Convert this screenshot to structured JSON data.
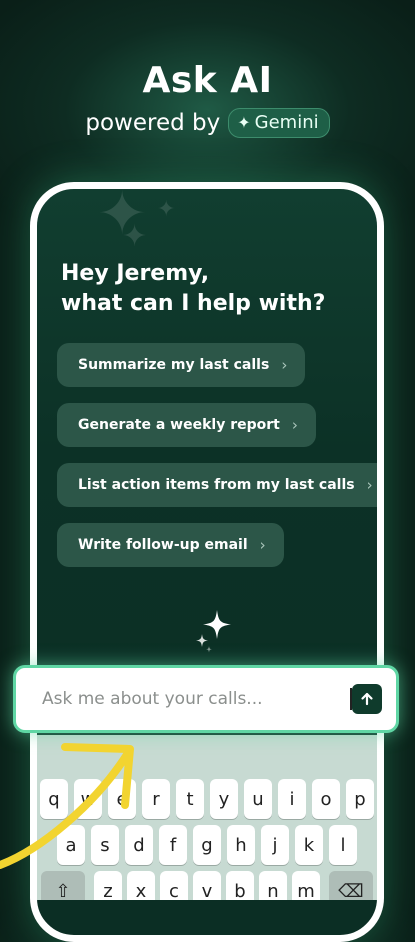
{
  "header": {
    "title": "Ask AI",
    "powered_by": "powered by",
    "badge_label": "Gemini"
  },
  "assistant": {
    "greeting": "Hey Jeremy,\nwhat can I help with?",
    "suggestions": [
      {
        "label": "Summarize my last calls"
      },
      {
        "label": "Generate a weekly report"
      },
      {
        "label": "List action items from my last calls"
      },
      {
        "label": "Write follow-up email"
      }
    ]
  },
  "input": {
    "placeholder": "Ask me about your calls..."
  },
  "keyboard": {
    "row1": [
      "q",
      "w",
      "e",
      "r",
      "t",
      "y",
      "u",
      "i",
      "o",
      "p"
    ],
    "row2": [
      "a",
      "s",
      "d",
      "f",
      "g",
      "h",
      "j",
      "k",
      "l"
    ],
    "row3": [
      "z",
      "x",
      "c",
      "v",
      "b",
      "n",
      "m"
    ]
  },
  "colors": {
    "background": "#0a1f18",
    "accent": "#5fd6a4",
    "chip": "#2c5648",
    "arrow": "#f2d430"
  },
  "icons": {
    "badge": "sparkle-icon",
    "chip": "chevron-right-icon",
    "send": "arrow-up-icon",
    "shift": "shift-icon",
    "backspace": "backspace-icon"
  }
}
